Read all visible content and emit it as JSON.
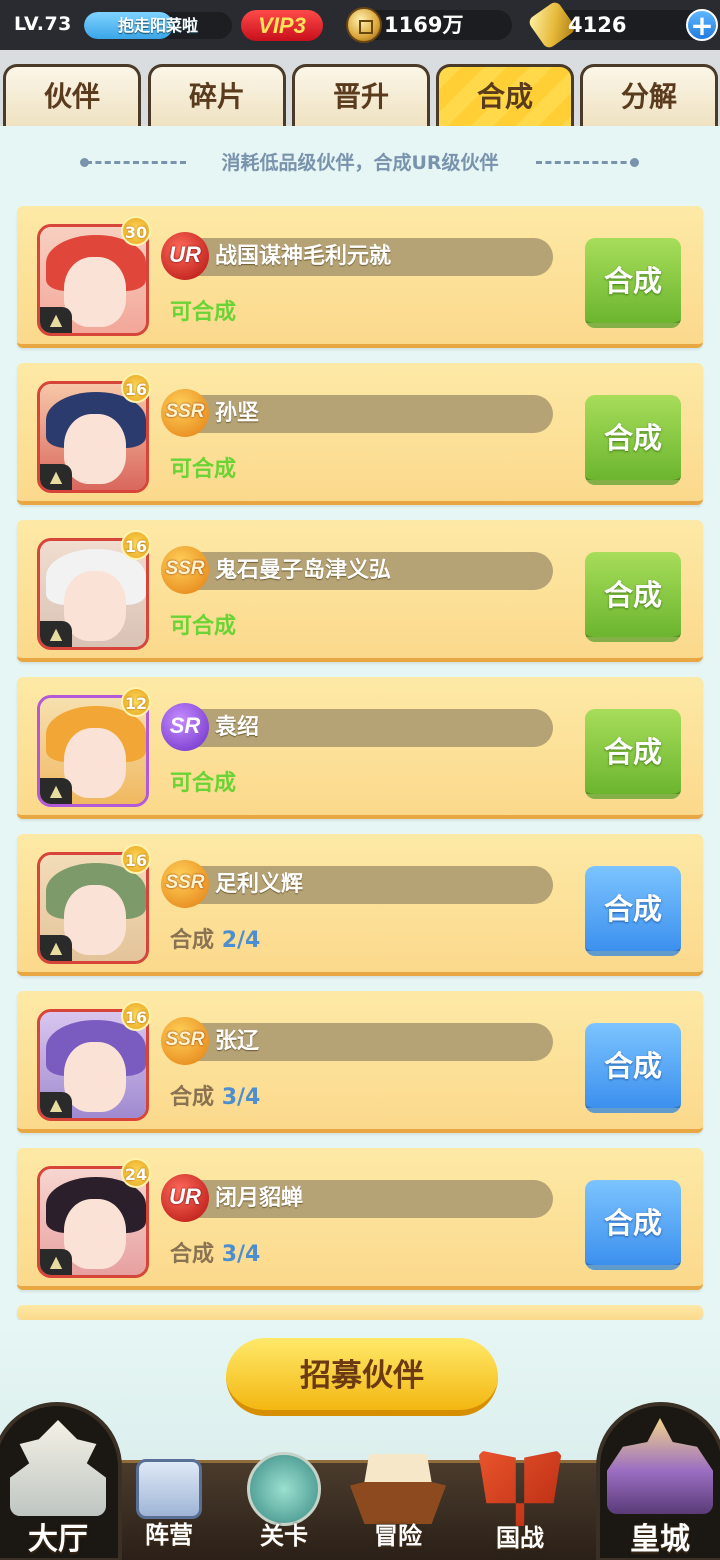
{
  "topbar": {
    "level": "LV.73",
    "player_name": "抱走阳菜啦",
    "vip": "VIP3",
    "coins": "1169万",
    "gold": "4126",
    "add_icon": "plus-icon"
  },
  "tabs": [
    {
      "label": "伙伴",
      "active": false
    },
    {
      "label": "碎片",
      "active": false
    },
    {
      "label": "晋升",
      "active": false
    },
    {
      "label": "合成",
      "active": true
    },
    {
      "label": "分解",
      "active": false
    }
  ],
  "hint": "消耗低品级伙伴，合成UR级伙伴",
  "cards": [
    {
      "rarity": "UR",
      "level": "30",
      "name": "战国谋神毛利元就",
      "status": "可合成",
      "button": "合成",
      "ready": true
    },
    {
      "rarity": "SSR",
      "level": "16",
      "name": "孙坚",
      "status": "可合成",
      "button": "合成",
      "ready": true
    },
    {
      "rarity": "SSR",
      "level": "16",
      "name": "鬼石曼子岛津义弘",
      "status": "可合成",
      "button": "合成",
      "ready": true
    },
    {
      "rarity": "SR",
      "level": "12",
      "name": "袁绍",
      "status": "可合成",
      "button": "合成",
      "ready": true
    },
    {
      "rarity": "SSR",
      "level": "16",
      "name": "足利义辉",
      "status_label": "合成",
      "status_count": "2/4",
      "button": "合成",
      "ready": false
    },
    {
      "rarity": "SSR",
      "level": "16",
      "name": "张辽",
      "status_label": "合成",
      "status_count": "3/4",
      "button": "合成",
      "ready": false
    },
    {
      "rarity": "UR",
      "level": "24",
      "name": "闭月貂蝉",
      "status_label": "合成",
      "status_count": "3/4",
      "button": "合成",
      "ready": false
    }
  ],
  "recruit_button": "招募伙伴",
  "nav": [
    {
      "label": "大厅",
      "icon": "castle-icon"
    },
    {
      "label": "阵营",
      "icon": "scroll-map-icon"
    },
    {
      "label": "关卡",
      "icon": "crossed-swords-icon"
    },
    {
      "label": "冒险",
      "icon": "ship-icon"
    },
    {
      "label": "国战",
      "icon": "war-banner-icon"
    },
    {
      "label": "皇城",
      "icon": "palace-icon"
    }
  ],
  "colors": {
    "ready_button": "#7cc13f",
    "progress_button": "#4a9cf2",
    "card_bg": "#fde39a",
    "active_tab": "#ffd640"
  }
}
